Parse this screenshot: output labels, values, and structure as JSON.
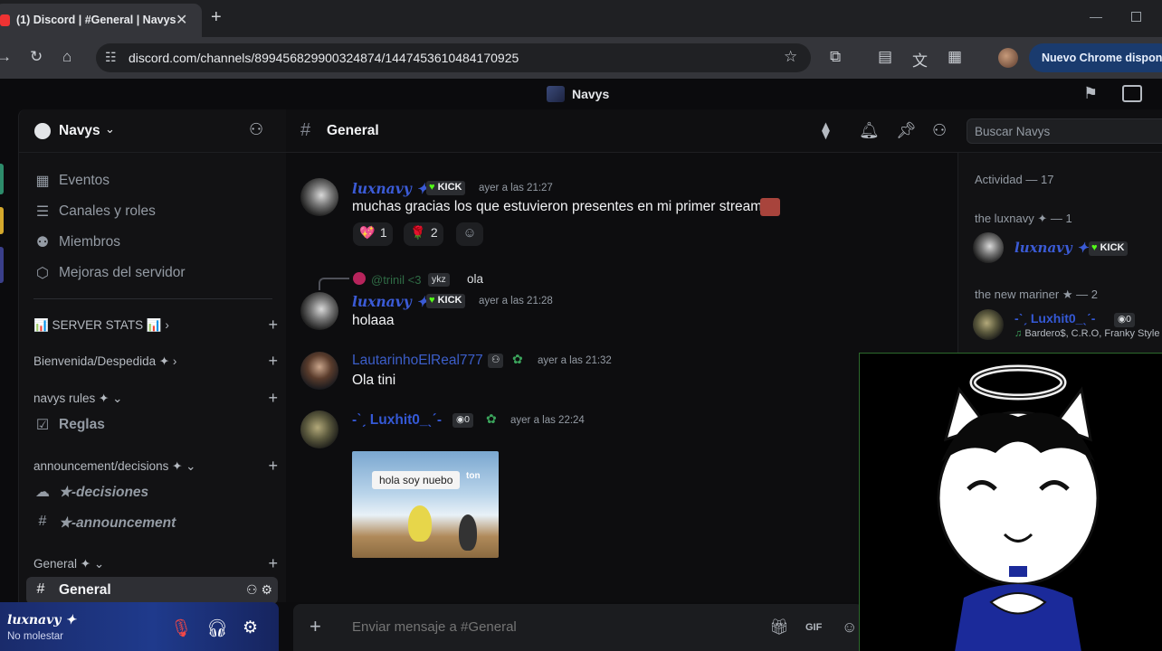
{
  "browser": {
    "tab_title": "(1) Discord | #General | Navys",
    "tab_close": "✕",
    "new_tab": "+",
    "url": "discord.com/channels/899456829900324874/1447453610484170925",
    "update_button": "Nuevo Chrome disponible"
  },
  "app": {
    "title": "Navys"
  },
  "guild": {
    "name": "Navys",
    "channels_top": [
      {
        "label": "Eventos",
        "icon": "calendar-icon"
      },
      {
        "label": "Canales y roles",
        "icon": "channels-roles-icon"
      },
      {
        "label": "Miembros",
        "icon": "members-icon"
      },
      {
        "label": "Mejoras del servidor",
        "icon": "boost-icon"
      }
    ],
    "categories": [
      {
        "label": "📊 SERVER STATS 📊 ›"
      },
      {
        "label": "Bienvenida/Despedida ✦ ›"
      },
      {
        "label": "navys rules ✦ ⌄"
      },
      {
        "label": "announcement/decisions ✦ ⌄"
      },
      {
        "label": "General ✦ ⌄"
      }
    ],
    "rules_channel": "Reglas",
    "decisions_channel": "★-decisiones",
    "announcement_channel": "★-announcement",
    "active_channel": "General"
  },
  "user_panel": {
    "name": "luxnavy ✦",
    "status": "No molestar"
  },
  "chat": {
    "channel_name": "General",
    "search_placeholder": "Buscar Navys",
    "composer_placeholder": "Enviar mensaje a #General",
    "messages": [
      {
        "author": "luxnavy ✦",
        "badge": "KICK",
        "time": "ayer a las 21:27",
        "text": "muchas gracias los que estuvieron presentes en mi primer stream",
        "reactions": [
          {
            "emoji": "💖",
            "count": "1"
          },
          {
            "emoji": "🌹",
            "count": "2"
          }
        ]
      },
      {
        "reply_author": "@trinil <3",
        "reply_tag": "ykz",
        "reply_text": "ola",
        "author": "luxnavy ✦",
        "badge": "KICK",
        "time": "ayer a las 21:28",
        "text": "holaaa"
      },
      {
        "author": "LautarinhoElReal777",
        "time": "ayer a las 21:32",
        "text": "Ola tini"
      },
      {
        "author": "-ˋˏ Luxhit0_ˎˊ-",
        "tag": "0",
        "time": "ayer a las 22:24",
        "image_caption": "hola soy nuebo",
        "image_caption_corner": "ton"
      }
    ]
  },
  "members": {
    "activity": "Actividad — 17",
    "section1": "the luxnavy ✦ — 1",
    "member1_name": "luxnavy ✦",
    "member1_badge": "KICK",
    "section2": "the new mariner ★ — 2",
    "member2_name": "-ˋˏ Luxhit0_ˎˊ-",
    "member2_tag": "0",
    "member2_activity": "Bardero$, C.R.O, Franky Style"
  },
  "colors": {
    "blurple": "#3b5bd6",
    "kick_green": "#53fc18",
    "user_panel": "#1f3a8c"
  }
}
